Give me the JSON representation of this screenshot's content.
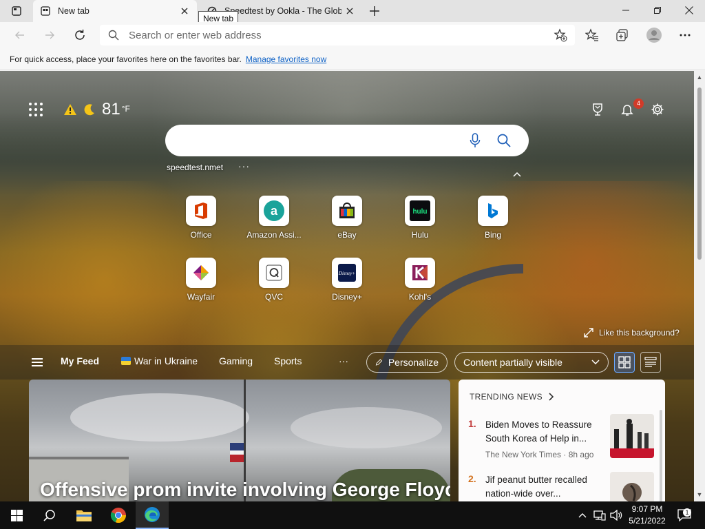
{
  "tabs": [
    {
      "title": "New tab",
      "active": true
    },
    {
      "title": "Speedtest by Ookla - The Global",
      "active": false
    }
  ],
  "tooltip": "New tab",
  "omnibox": {
    "placeholder": "Search or enter web address"
  },
  "favbar": {
    "message": "For quick access, place your favorites here on the favorites bar.",
    "link": "Manage favorites now"
  },
  "weather": {
    "temp": "81",
    "unit": "°F"
  },
  "notifications": {
    "count": "4"
  },
  "recent_search": "speedtest.nmet",
  "tiles": [
    {
      "label": "Office",
      "icon": "office-icon",
      "color": "#d83b01"
    },
    {
      "label": "Amazon Assi...",
      "icon": "amazon-icon",
      "color": "#1aa39a"
    },
    {
      "label": "eBay",
      "icon": "ebay-icon",
      "color": "#e53238"
    },
    {
      "label": "Hulu",
      "icon": "hulu-icon",
      "color": "#1ce783"
    },
    {
      "label": "Bing",
      "icon": "bing-icon",
      "color": "#0078d4"
    },
    {
      "label": "Wayfair",
      "icon": "wayfair-icon",
      "color": "#7f187f"
    },
    {
      "label": "QVC",
      "icon": "qvc-icon",
      "color": "#333333"
    },
    {
      "label": "Disney+",
      "icon": "disney-icon",
      "color": "#113ccf"
    },
    {
      "label": "Kohl's",
      "icon": "kohls-icon",
      "color": "#8b1e5b"
    }
  ],
  "like_background": "Like this background?",
  "feednav": {
    "items": [
      "My Feed",
      "War in Ukraine",
      "Gaming",
      "Sports"
    ],
    "more": "···",
    "personalize": "Personalize",
    "visibility": "Content partially visible"
  },
  "hero": {
    "headline": "Offensive prom invite involving George Floyd"
  },
  "trending": {
    "header": "TRENDING NEWS",
    "items": [
      {
        "num": "1.",
        "title": "Biden Moves to Reassure South Korea of Help in...",
        "source": "The New York Times · 8h ago"
      },
      {
        "num": "2.",
        "title": "Jif peanut butter recalled nation-wide over...",
        "source": ""
      }
    ]
  },
  "clock": {
    "time": "9:07 PM",
    "date": "5/21/2022"
  },
  "action_center": {
    "count": "1"
  }
}
